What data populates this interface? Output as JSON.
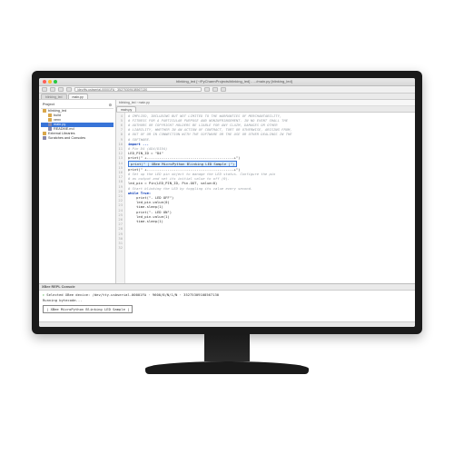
{
  "window": {
    "title": "blinking_led [~/PyCharmProjects/blinking_led] - .../main.py [blinking_led]"
  },
  "toolbar": {
    "path": "/dev/tty.usbserial-00001FA · 35275309108567130"
  },
  "top_tabs": [
    {
      "label": "blinking_led"
    },
    {
      "label": "main.py"
    }
  ],
  "sidebar": {
    "header": "Project",
    "items": [
      {
        "icon": "folder",
        "label": "blinking_led",
        "hint": "~/PyCharmProjects/blinking_led",
        "indent": 0,
        "sel": false
      },
      {
        "icon": "folder",
        "label": "build",
        "indent": 1,
        "sel": false
      },
      {
        "icon": "folder",
        "label": "venv",
        "indent": 1,
        "sel": false
      },
      {
        "icon": "file",
        "label": "main.py",
        "indent": 1,
        "sel": true
      },
      {
        "icon": "file",
        "label": "README.md",
        "indent": 1,
        "sel": false
      },
      {
        "icon": "folder",
        "label": "External Libraries",
        "indent": 0,
        "sel": false
      },
      {
        "icon": "file",
        "label": "Scratches and Consoles",
        "indent": 0,
        "sel": false
      }
    ]
  },
  "breadcrumb": "blinking_led  ›  main.py",
  "editor_tabs": {
    "active": "main.py"
  },
  "code": [
    {
      "n": 4,
      "cls": "c-comment",
      "t": "# IMPLIED, INCLUDING BUT NOT LIMITED TO THE WARRANTIES OF MERCHANTABILITY,"
    },
    {
      "n": 5,
      "cls": "c-comment",
      "t": "# FITNESS FOR A PARTICULAR PURPOSE AND NONINFRINGEMENT. IN NO EVENT SHALL THE"
    },
    {
      "n": 6,
      "cls": "c-comment",
      "t": "# AUTHORS OR COPYRIGHT HOLDERS BE LIABLE FOR ANY CLAIM, DAMAGES OR OTHER"
    },
    {
      "n": 7,
      "cls": "c-comment",
      "t": "# LIABILITY, WHETHER IN AN ACTION OF CONTRACT, TORT OR OTHERWISE, ARISING FROM,"
    },
    {
      "n": 8,
      "cls": "c-comment",
      "t": "# OUT OF OR IN CONNECTION WITH THE SOFTWARE OR THE USE OR OTHER DEALINGS IN THE"
    },
    {
      "n": 9,
      "cls": "c-comment",
      "t": "# SOFTWARE."
    },
    {
      "n": 10,
      "cls": "",
      "t": ""
    },
    {
      "n": 11,
      "cls": "c-kw",
      "t": "import ..."
    },
    {
      "n": 12,
      "cls": "",
      "t": ""
    },
    {
      "n": 13,
      "cls": "c-comment",
      "t": "# Pin D4 (AD4/DIO4)"
    },
    {
      "n": 14,
      "cls": "",
      "t": "LED_PIN_ID = \"D4\""
    },
    {
      "n": 15,
      "cls": "",
      "t": ""
    },
    {
      "n": 16,
      "cls": "",
      "t": "print(\" +------------------------------------------+\")"
    },
    {
      "n": 17,
      "cls": "hl",
      "t": "print(\" | XBee MicroPython Blinking LED Sample |\")"
    },
    {
      "n": 18,
      "cls": "",
      "t": "print(\" +------------------------------------------+\")"
    },
    {
      "n": 19,
      "cls": "",
      "t": ""
    },
    {
      "n": 20,
      "cls": "c-comment",
      "t": "# Set up the LED pin object to manage the LED status. Configure the pin"
    },
    {
      "n": 21,
      "cls": "c-comment",
      "t": "# as output and set its initial value to off (0)."
    },
    {
      "n": 22,
      "cls": "",
      "t": "led_pin = Pin(LED_PIN_ID, Pin.OUT, value=0)"
    },
    {
      "n": 23,
      "cls": "",
      "t": ""
    },
    {
      "n": 24,
      "cls": "c-comment",
      "t": "# Start blinking the LED by toggling its value every second."
    },
    {
      "n": 25,
      "cls": "c-kw",
      "t": "while True:"
    },
    {
      "n": 26,
      "cls": "",
      "t": "    print(\"- LED OFF\")"
    },
    {
      "n": 27,
      "cls": "",
      "t": "    led_pin.value(0)"
    },
    {
      "n": 28,
      "cls": "",
      "t": "    time.sleep(1)"
    },
    {
      "n": 29,
      "cls": "",
      "t": ""
    },
    {
      "n": 30,
      "cls": "",
      "t": "    print(\"- LED ON\")"
    },
    {
      "n": 31,
      "cls": "",
      "t": "    led_pin.value(1)"
    },
    {
      "n": 32,
      "cls": "",
      "t": "    time.sleep(1)"
    }
  ],
  "console": {
    "tab": "XBee REPL Console",
    "device_label": "Selected XBee device: /dev/tty.usbserial-00001FA · 9600/8/N/1/N · 35275309108567130",
    "running": "Running bytecode...",
    "result": "| XBee MicroPython Blinking LED Sample |"
  }
}
